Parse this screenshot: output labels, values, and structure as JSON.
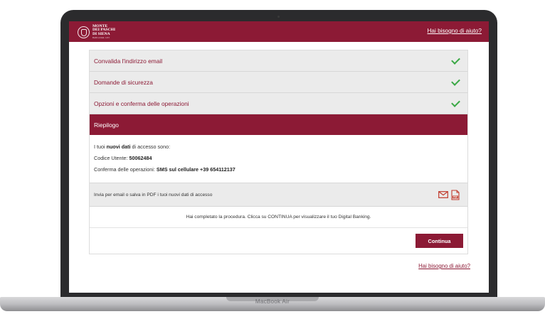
{
  "header": {
    "logo_line1": "MONTE",
    "logo_line2": "DEI PASCHI",
    "logo_line3": "DI SIENA",
    "logo_tagline": "BANCA DAL 1472",
    "help_link": "Hai bisogno di aiuto?"
  },
  "steps": [
    {
      "label": "Convalida l'indirizzo email",
      "status": "completed"
    },
    {
      "label": "Domande di sicurezza",
      "status": "completed"
    },
    {
      "label": "Opzioni e conferma delle operazioni",
      "status": "completed"
    }
  ],
  "active_step": {
    "label": "Riepilogo"
  },
  "summary": {
    "intro_pre": "I tuoi ",
    "intro_bold": "nuovi dati",
    "intro_post": " di accesso sono:",
    "user_code_label": "Codice Utente: ",
    "user_code_value": "50062484",
    "confirm_label": "Conferma delle operazioni: ",
    "confirm_value": "SMS sul cellulare +39 654112137"
  },
  "share": {
    "text": "Invia per email o salva in PDF i tuoi nuovi dati di accesso",
    "email_icon": "envelope-icon",
    "pdf_icon": "pdf-icon"
  },
  "completion_message": "Hai completato la procedura. Clicca su CONTINUA per visualizzare il tuo Digital Banking.",
  "continue_button": "Continua",
  "footer_help_link": "Hai bisogno di aiuto?",
  "device_label": "MacBook Air",
  "colors": {
    "brand": "#8c1a35",
    "check": "#3aa845",
    "step_bg": "#ebebeb"
  }
}
